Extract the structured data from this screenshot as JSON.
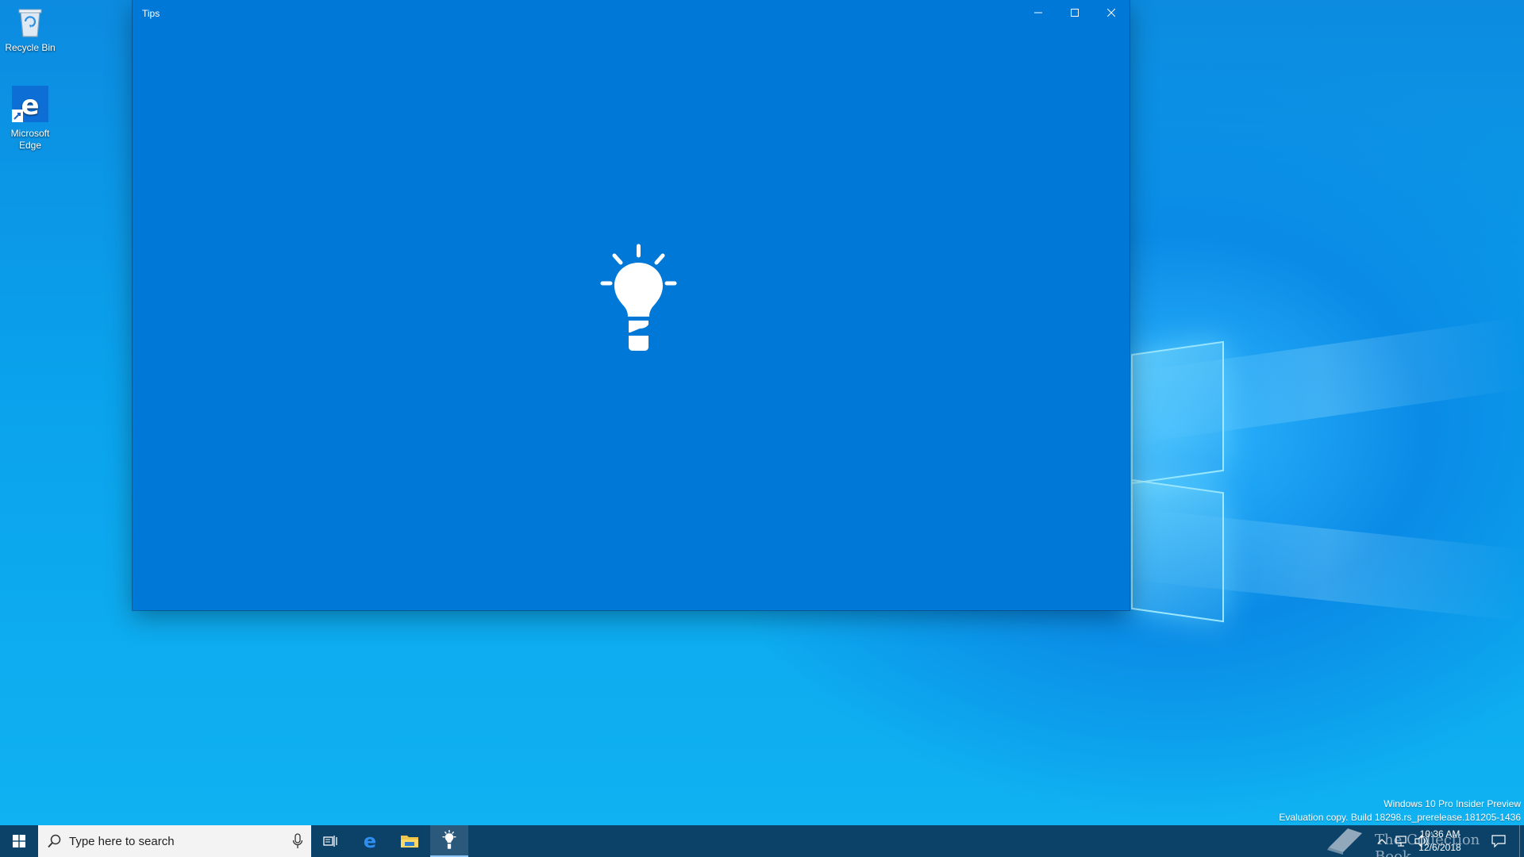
{
  "desktop": {
    "icons": [
      {
        "label": "Recycle Bin",
        "icon": "recycle-bin-icon"
      },
      {
        "label": "Microsoft Edge",
        "icon": "edge-icon"
      }
    ]
  },
  "window": {
    "title": "Tips",
    "content_icon": "lightbulb-icon",
    "accent": "#0078d7"
  },
  "watermark": {
    "line1": "Windows 10 Pro Insider Preview",
    "line2": "Evaluation copy. Build 18298.rs_prerelease.181205-1436"
  },
  "taskbar": {
    "search_placeholder": "Type here to search",
    "pinned": [
      "task-view-icon",
      "edge-icon",
      "file-explorer-icon",
      "tips-icon"
    ],
    "active_app": "Tips",
    "time": "10:36 AM",
    "date": "12/6/2018"
  },
  "brand_watermark": "The Collection Book"
}
